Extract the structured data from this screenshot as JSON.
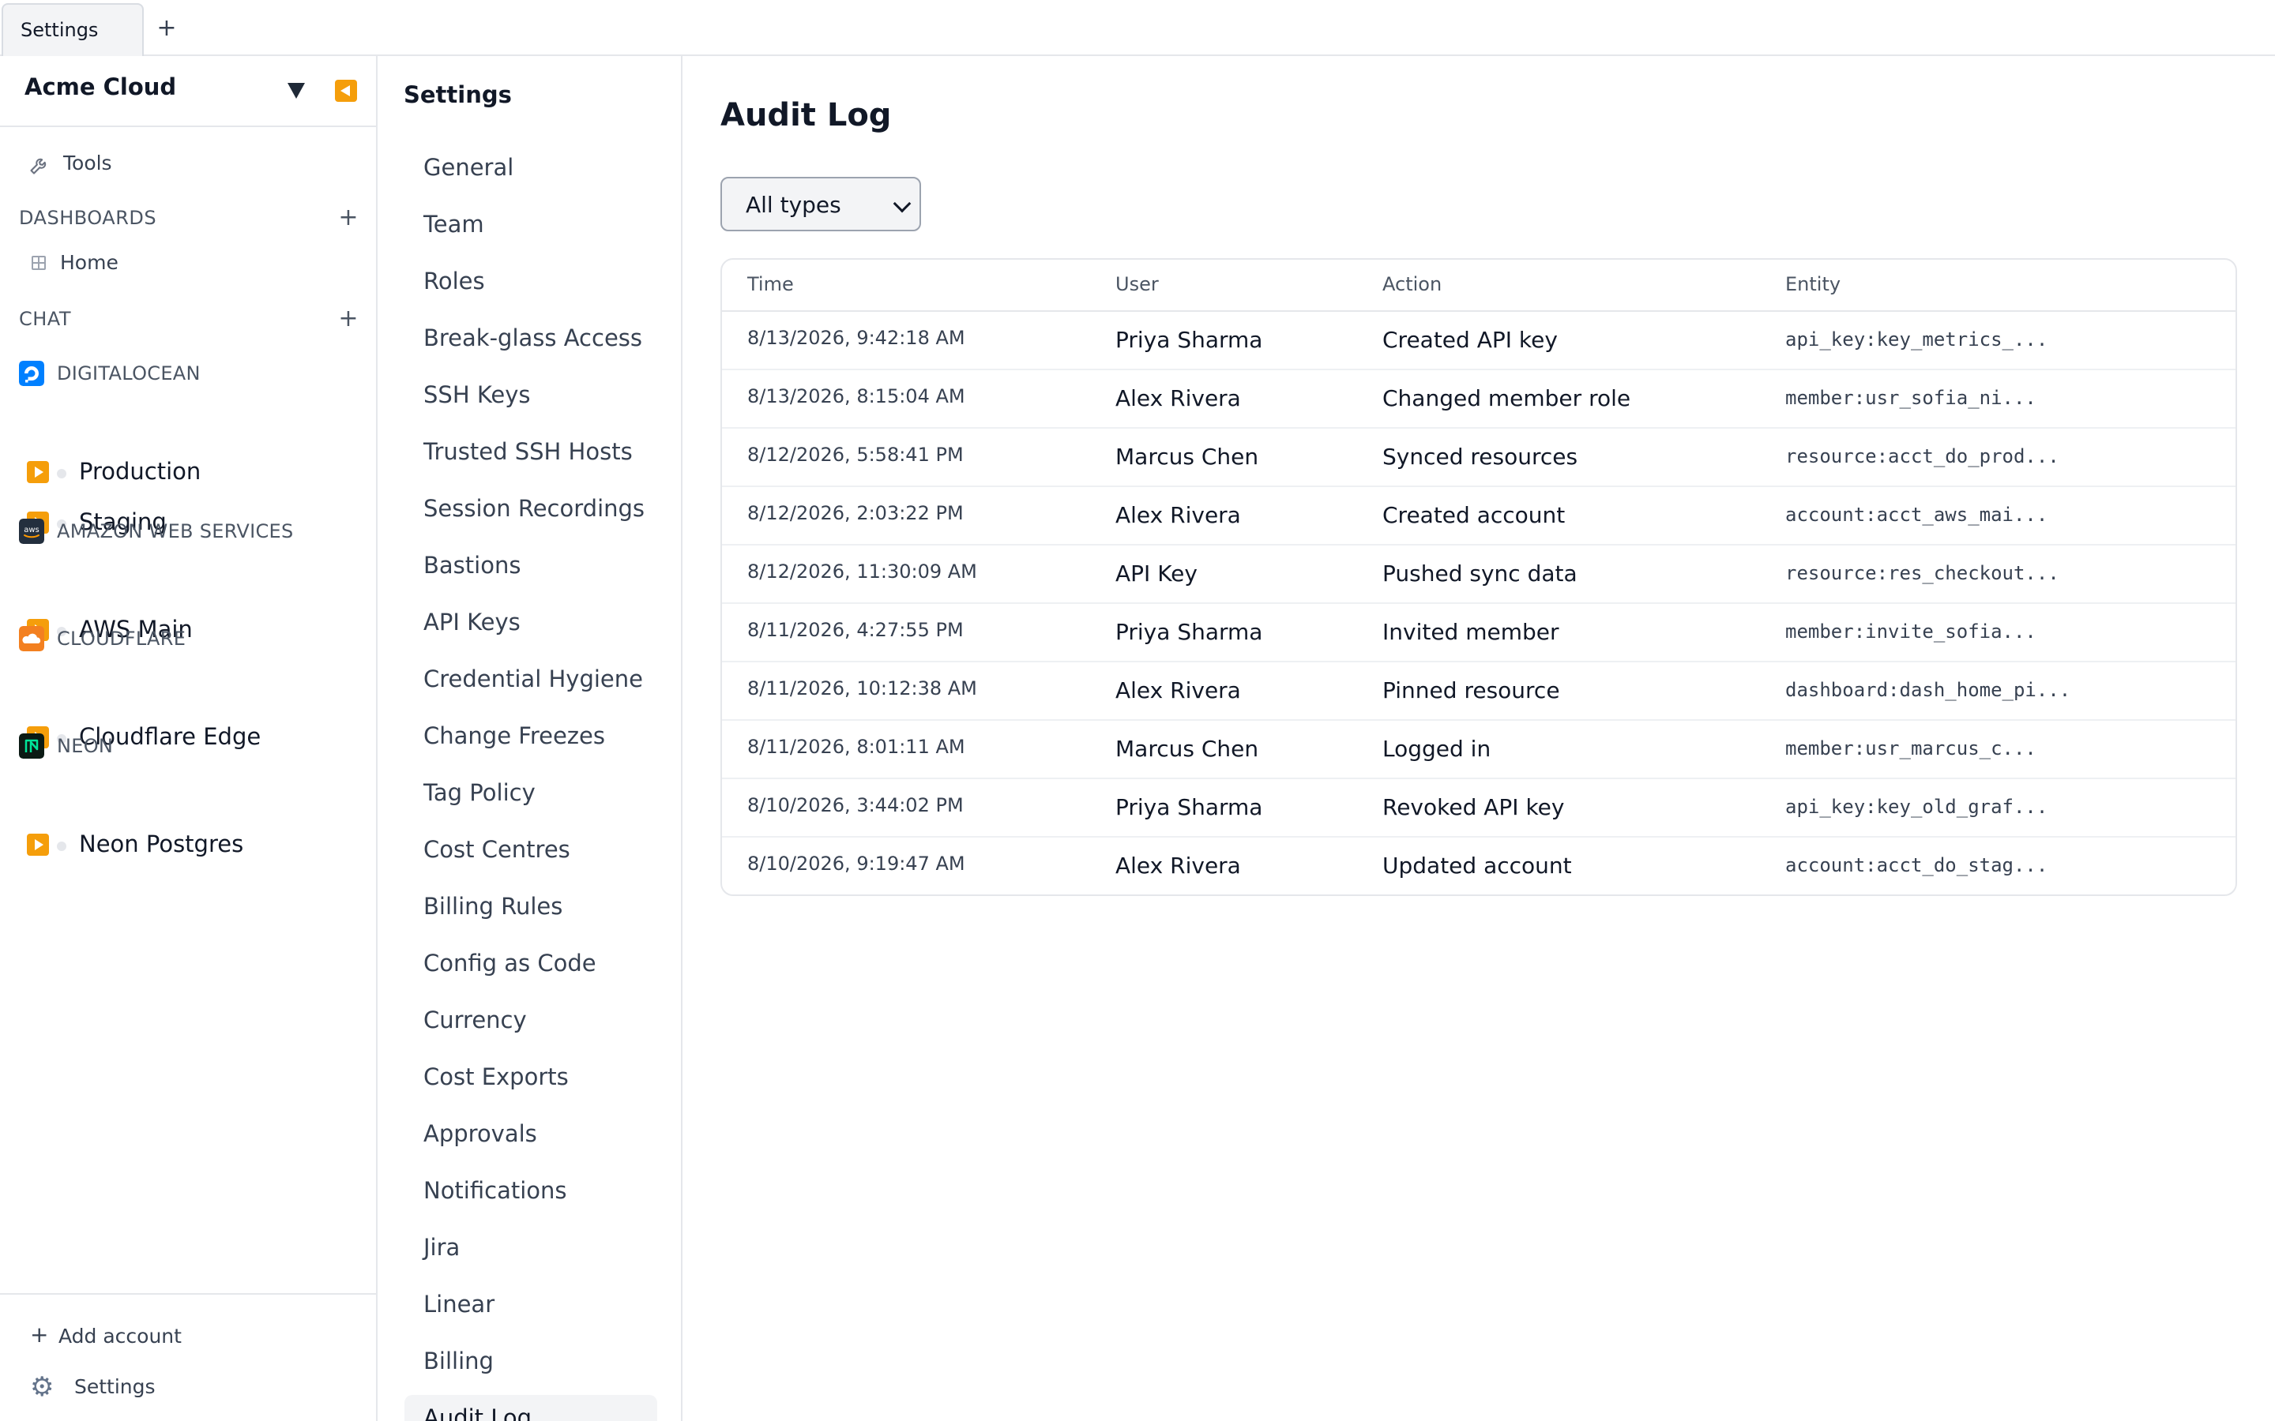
{
  "tabs": [
    {
      "label": "Settings"
    }
  ],
  "workspace": {
    "name": "Acme Cloud"
  },
  "sidebar": {
    "tools_label": "Tools",
    "dashboards_title": "DASHBOARDS",
    "home_label": "Home",
    "chat_title": "CHAT",
    "providers": [
      {
        "name": "DIGITALOCEAN",
        "logo_color": "#0080ff",
        "accounts": [
          "Production",
          "Staging"
        ]
      },
      {
        "name": "AMAZON WEB SERVICES",
        "logo_color": "#232f3e",
        "logo_text": "aws",
        "accounts": [
          "AWS Main"
        ]
      },
      {
        "name": "CLOUDFLARE",
        "logo_color": "#f38020",
        "accounts": [
          "Cloudflare Edge"
        ]
      },
      {
        "name": "NEON",
        "logo_color": "#0b1a14",
        "accounts": [
          "Neon Postgres"
        ]
      }
    ],
    "add_account_label": "Add account",
    "settings_label": "Settings"
  },
  "settings_nav": {
    "title": "Settings",
    "items": [
      "General",
      "Team",
      "Roles",
      "Break-glass Access",
      "SSH Keys",
      "Trusted SSH Hosts",
      "Session Recordings",
      "Bastions",
      "API Keys",
      "Credential Hygiene",
      "Change Freezes",
      "Tag Policy",
      "Cost Centres",
      "Billing Rules",
      "Config as Code",
      "Currency",
      "Cost Exports",
      "Approvals",
      "Notifications",
      "Jira",
      "Linear",
      "Billing",
      "Audit Log"
    ],
    "active": "Audit Log"
  },
  "main": {
    "title": "Audit Log",
    "filter": {
      "selected": "All types"
    },
    "table": {
      "columns": [
        "Time",
        "User",
        "Action",
        "Entity"
      ],
      "rows": [
        {
          "time": "8/13/2026, 9:42:18 AM",
          "user": "Priya Sharma",
          "action": "Created API key",
          "entity": "api_key:key_metrics_..."
        },
        {
          "time": "8/13/2026, 8:15:04 AM",
          "user": "Alex Rivera",
          "action": "Changed member role",
          "entity": "member:usr_sofia_ni..."
        },
        {
          "time": "8/12/2026, 5:58:41 PM",
          "user": "Marcus Chen",
          "action": "Synced resources",
          "entity": "resource:acct_do_prod..."
        },
        {
          "time": "8/12/2026, 2:03:22 PM",
          "user": "Alex Rivera",
          "action": "Created account",
          "entity": "account:acct_aws_mai..."
        },
        {
          "time": "8/12/2026, 11:30:09 AM",
          "user": "API Key",
          "action": "Pushed sync data",
          "entity": "resource:res_checkout..."
        },
        {
          "time": "8/11/2026, 4:27:55 PM",
          "user": "Priya Sharma",
          "action": "Invited member",
          "entity": "member:invite_sofia..."
        },
        {
          "time": "8/11/2026, 10:12:38 AM",
          "user": "Alex Rivera",
          "action": "Pinned resource",
          "entity": "dashboard:dash_home_pi..."
        },
        {
          "time": "8/11/2026, 8:01:11 AM",
          "user": "Marcus Chen",
          "action": "Logged in",
          "entity": "member:usr_marcus_c..."
        },
        {
          "time": "8/10/2026, 3:44:02 PM",
          "user": "Priya Sharma",
          "action": "Revoked API key",
          "entity": "api_key:key_old_graf..."
        },
        {
          "time": "8/10/2026, 9:19:47 AM",
          "user": "Alex Rivera",
          "action": "Updated account",
          "entity": "account:acct_do_stag..."
        }
      ]
    }
  }
}
